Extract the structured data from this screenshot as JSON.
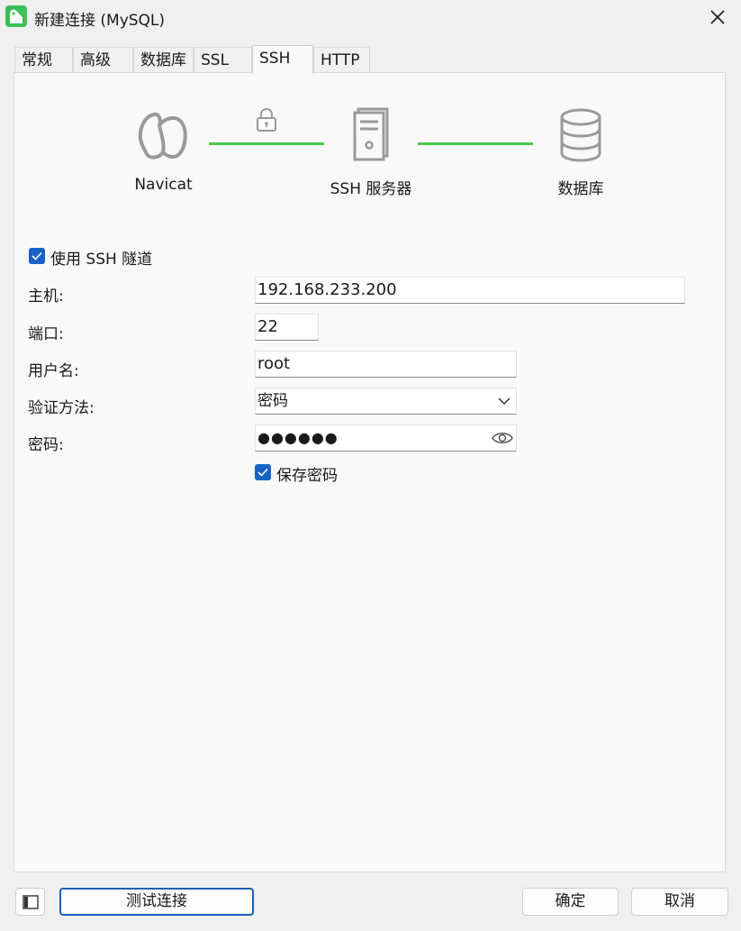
{
  "window": {
    "title": "新建连接 (MySQL)"
  },
  "tabs": [
    {
      "label": "常规"
    },
    {
      "label": "高级"
    },
    {
      "label": "数据库"
    },
    {
      "label": "SSL"
    },
    {
      "label": "SSH",
      "active": true
    },
    {
      "label": "HTTP"
    }
  ],
  "diagram": {
    "client_label": "Navicat",
    "server_label": "SSH 服务器",
    "database_label": "数据库",
    "line_color": "#4cc94c"
  },
  "ssh": {
    "use_tunnel_label": "使用 SSH 隧道",
    "use_tunnel_checked": true,
    "host_label": "主机:",
    "host_value": "192.168.233.200",
    "port_label": "端口:",
    "port_value": "22",
    "username_label": "用户名:",
    "username_value": "root",
    "auth_label": "验证方法:",
    "auth_value": "密码",
    "password_label": "密码:",
    "password_value": "●●●●●●",
    "save_password_label": "保存密码",
    "save_password_checked": true
  },
  "footer": {
    "test_button": "测试连接",
    "ok_button": "确定",
    "cancel_button": "取消"
  },
  "colors": {
    "accent": "#1762c4",
    "app_icon": "#3bbf57"
  }
}
